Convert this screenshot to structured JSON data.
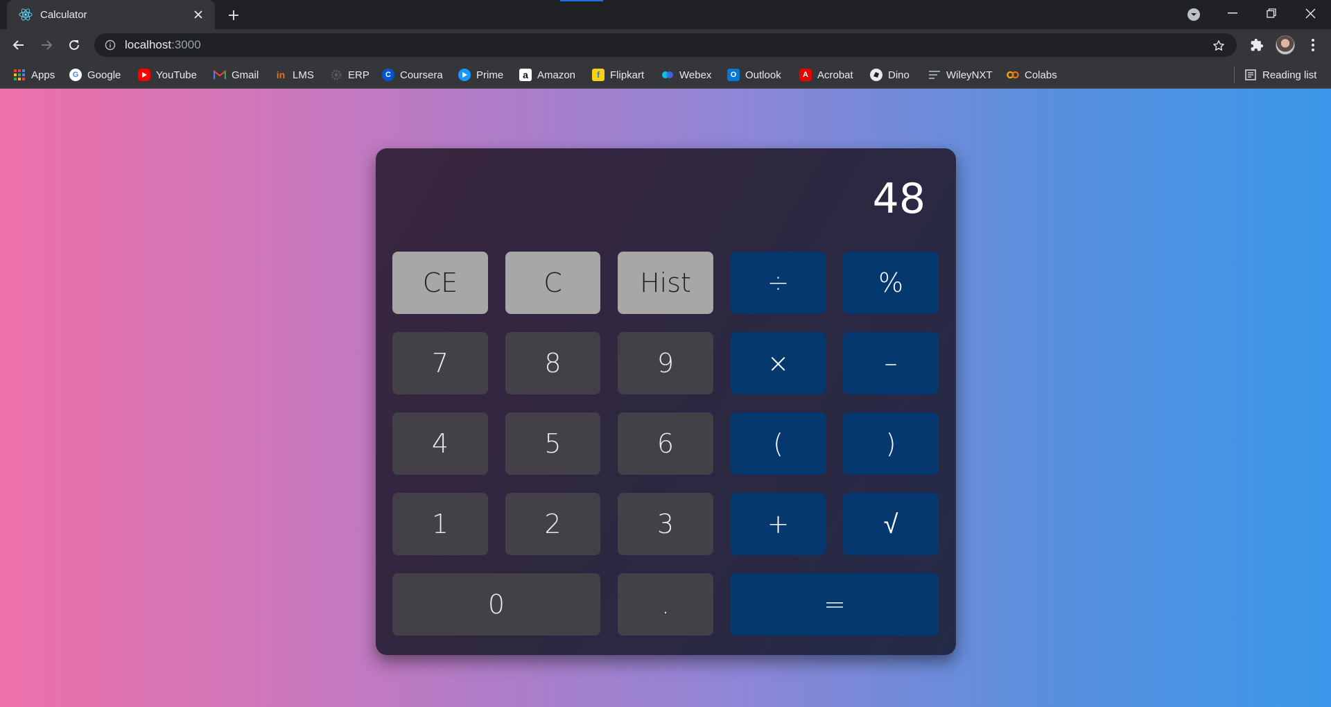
{
  "browser": {
    "tab": {
      "title": "Calculator",
      "favicon": "react-icon"
    },
    "address": {
      "host": "localhost",
      "port": ":3000"
    },
    "bookmarks": [
      {
        "label": "Apps",
        "icon": "apps-grid-icon",
        "color": "#ea4335"
      },
      {
        "label": "Google",
        "icon": "google-icon",
        "color": "#4285f4"
      },
      {
        "label": "YouTube",
        "icon": "youtube-icon",
        "color": "#ff0000"
      },
      {
        "label": "Gmail",
        "icon": "gmail-icon",
        "color": "#ea4335"
      },
      {
        "label": "LMS",
        "icon": "lms-icon",
        "color": "#e8711c"
      },
      {
        "label": "ERP",
        "icon": "erp-icon",
        "color": "#4d4d4d"
      },
      {
        "label": "Coursera",
        "icon": "coursera-icon",
        "color": "#0056d2"
      },
      {
        "label": "Prime",
        "icon": "prime-video-icon",
        "color": "#1a98ff"
      },
      {
        "label": "Amazon",
        "icon": "amazon-icon",
        "color": "#ffffff"
      },
      {
        "label": "Flipkart",
        "icon": "flipkart-icon",
        "color": "#f8d210"
      },
      {
        "label": "Webex",
        "icon": "webex-icon",
        "color": "#07c3e0"
      },
      {
        "label": "Outlook",
        "icon": "outlook-icon",
        "color": "#0078d4"
      },
      {
        "label": "Acrobat",
        "icon": "acrobat-icon",
        "color": "#e10600"
      },
      {
        "label": "Dino",
        "icon": "dino-icon",
        "color": "#e8eaed"
      },
      {
        "label": "WileyNXT",
        "icon": "wileynxt-icon",
        "color": "#9aa0a6"
      },
      {
        "label": "Colabs",
        "icon": "colab-icon",
        "color": "#f9ab00"
      }
    ],
    "reading_list": "Reading list"
  },
  "calculator": {
    "display": "48",
    "keys": {
      "ce": "CE",
      "c": "C",
      "hist": "Hist",
      "divide": "÷",
      "percent": "%",
      "seven": "7",
      "eight": "8",
      "nine": "9",
      "multiply": "×",
      "minus": "–",
      "four": "4",
      "five": "5",
      "six": "6",
      "lparen": "(",
      "rparen": ")",
      "one": "1",
      "two": "2",
      "three": "3",
      "plus": "+",
      "sqrt": "√",
      "zero": "0",
      "dot": ".",
      "equals": "="
    }
  },
  "colors": {
    "fn_key": "#a7a7a7",
    "num_key": "#444048",
    "op_key": "#04386f",
    "gradient_left": "#ee70a9",
    "gradient_right": "#3a97e9"
  }
}
